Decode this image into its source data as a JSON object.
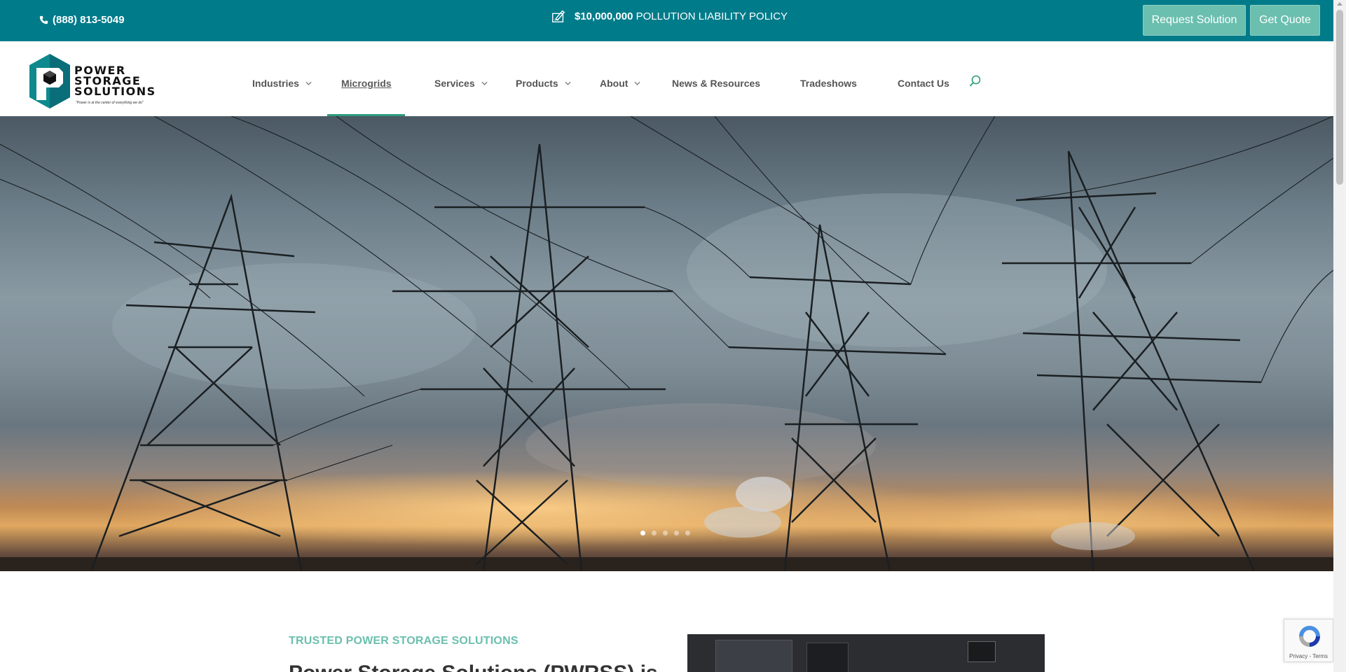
{
  "topbar": {
    "phone": "(888) 813-5049",
    "promo_amount": "$10,000,000",
    "promo_text": "POLLUTION LIABILITY POLICY",
    "request_button": "Request Solution",
    "quote_button": "Get Quote"
  },
  "brand": {
    "logo_line1": "POWER",
    "logo_line2": "STORAGE",
    "logo_line3": "SOLUTIONS",
    "tagline": "\"Power is at the center of everything we do\""
  },
  "nav": {
    "items": [
      {
        "label": "Industries",
        "has_dropdown": true
      },
      {
        "label": "Microgrids",
        "has_dropdown": false,
        "active": true
      },
      {
        "label": "Services",
        "has_dropdown": true
      },
      {
        "label": "Products",
        "has_dropdown": true
      },
      {
        "label": "About",
        "has_dropdown": true
      },
      {
        "label": "News & Resources",
        "has_dropdown": false
      },
      {
        "label": "Tradeshows",
        "has_dropdown": false
      },
      {
        "label": "Contact Us",
        "has_dropdown": false
      }
    ],
    "search_icon": "search-icon"
  },
  "hero": {
    "slide_count": 5,
    "active_slide": 1
  },
  "content": {
    "eyebrow": "TRUSTED POWER STORAGE SOLUTIONS",
    "heading_partial": "Power Storage Solutions (PWRSS) is"
  },
  "recaptcha": {
    "links": "Privacy - Terms"
  },
  "colors": {
    "topbar": "#007b8a",
    "button": "#6bbfae",
    "accent": "#2e9b7c"
  }
}
